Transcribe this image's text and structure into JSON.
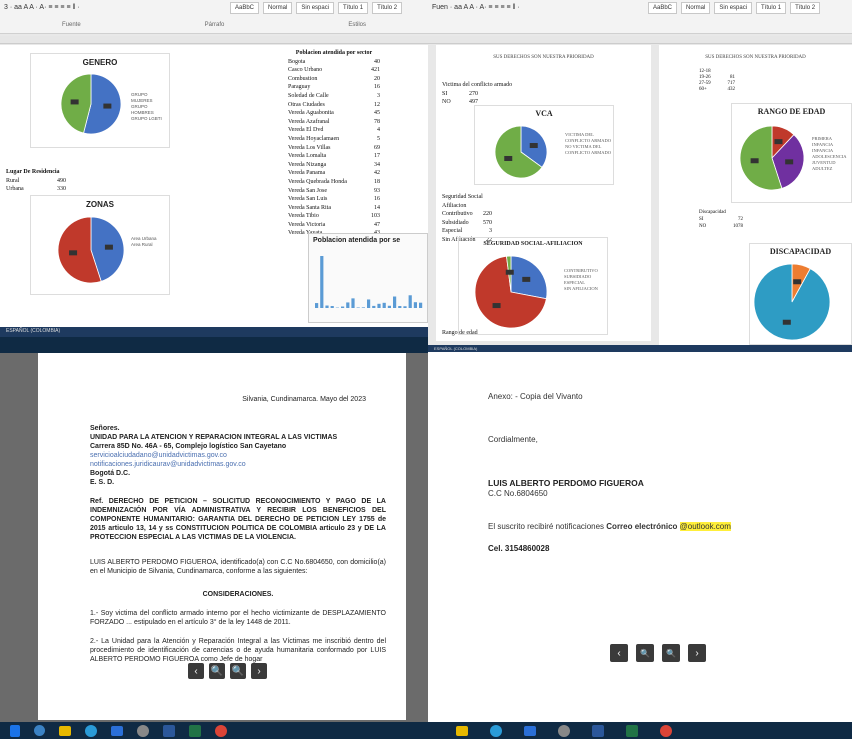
{
  "top_left": {
    "ribbon_text": "Fuente",
    "style_label": "Normal",
    "group_labels": [
      "Fuente",
      "Párrafo",
      "Estilos"
    ],
    "chart_genero": {
      "title": "GENERO",
      "slices": [
        {
          "value": 54,
          "color": "#4472c4"
        },
        {
          "value": 46,
          "color": "#70ad47"
        }
      ],
      "legend": [
        "GRUPO MUJERES",
        "GRUPO HOMBRES",
        "GRUPO LGBTI"
      ]
    },
    "residence_title": "Lugar De Residencia",
    "residence_rows": [
      {
        "k": "Rural",
        "v": "490"
      },
      {
        "k": "Urbana",
        "v": "330"
      }
    ],
    "chart_zonas": {
      "title": "ZONAS",
      "slices": [
        {
          "value": 45,
          "color": "#4472c4"
        },
        {
          "value": 55,
          "color": "#c0392b"
        }
      ],
      "legend": [
        "Area Urbana",
        "Area Rural"
      ]
    },
    "poblacion_title": "Poblacion atendida por sector",
    "sectors": [
      {
        "k": "Bogota",
        "v": "40"
      },
      {
        "k": "Casco Urbano",
        "v": "421"
      },
      {
        "k": "Combustion",
        "v": "20"
      },
      {
        "k": "Paraguay",
        "v": "16"
      },
      {
        "k": "Soledad de Calle",
        "v": "3"
      },
      {
        "k": "Otras Ciudades",
        "v": "12"
      },
      {
        "k": "Vereda Aguabonita",
        "v": "45"
      },
      {
        "k": "Vereda Azafranal",
        "v": "78"
      },
      {
        "k": "Vereda El Dvd",
        "v": "4"
      },
      {
        "k": "Vereda Hoyaclamaen",
        "v": "5"
      },
      {
        "k": "Vereda Los Villas",
        "v": "69"
      },
      {
        "k": "Vereda Lomalta",
        "v": "17"
      },
      {
        "k": "Vereda Nizanga",
        "v": "34"
      },
      {
        "k": "Vereda Panama",
        "v": "42"
      },
      {
        "k": "Vereda Quebrada Honda",
        "v": "18"
      },
      {
        "k": "Vereda San Jose",
        "v": "93"
      },
      {
        "k": "Vereda San Luis",
        "v": "16"
      },
      {
        "k": "Vereda Santa Rita",
        "v": "14"
      },
      {
        "k": "Vereda Tibio",
        "v": "103"
      },
      {
        "k": "Vereda Victoria",
        "v": "47"
      },
      {
        "k": "Vereda Yayata",
        "v": "43"
      }
    ],
    "bar_chart_title": "Poblacion atendida por se"
  },
  "top_right": {
    "ribbon_text": "Fuente",
    "style_label": "Normal",
    "heading": "SUS DERECHOS SON NUESTRA PRIORIDAD",
    "victim_label": "Victima del conflicto armado",
    "victim_rows": [
      {
        "k": "SI",
        "v": "270"
      },
      {
        "k": "NO",
        "v": "497"
      }
    ],
    "chart_vca": {
      "title": "VCA",
      "slices": [
        {
          "value": 35,
          "color": "#4472c4"
        },
        {
          "value": 65,
          "color": "#70ad47"
        }
      ],
      "legend": [
        "VICTIMA DEL CONFLICTO ARMADO",
        "NO VICTIMA DEL CONFLICTO ARMADO"
      ]
    },
    "ss_label": "Seguridad Social Afiliacion",
    "ss_rows": [
      {
        "k": "Contributivo",
        "v": "220"
      },
      {
        "k": "Subsidiado",
        "v": "570"
      },
      {
        "k": "Especial",
        "v": "3"
      },
      {
        "k": "Sin Afiliación",
        "v": "22"
      }
    ],
    "chart_ss": {
      "title": "SEGURIDAD SOCIAL-AFILIACION",
      "slices": [
        {
          "value": 28,
          "color": "#4472c4"
        },
        {
          "value": 70,
          "color": "#c0392b"
        },
        {
          "value": 2,
          "color": "#70ad47"
        }
      ],
      "legend": [
        "CONTRIBUTIVO",
        "SUBSIDIADO",
        "ESPECIAL",
        "SIN AFILIACION"
      ]
    },
    "rango_label": "Rango de edad",
    "age_rows": [
      {
        "k": "12-18",
        "v": ""
      },
      {
        "k": "19-26",
        "v": "81"
      },
      {
        "k": "27-59",
        "v": "717"
      },
      {
        "k": "60+",
        "v": "432"
      }
    ],
    "chart_edad": {
      "title": "RANGO DE EDAD",
      "slices": [
        {
          "value": 12,
          "color": "#c0392b"
        },
        {
          "value": 33,
          "color": "#7030a0"
        },
        {
          "value": 55,
          "color": "#70ad47"
        }
      ],
      "legend": [
        "PRIMERA INFANCIA",
        "INFANCIA",
        "ADOLESCENCIA",
        "JUVENTUD",
        "ADULTEZ"
      ]
    },
    "disc_label": "Discapacidad",
    "disc_rows": [
      {
        "k": "SI",
        "v": "72"
      },
      {
        "k": "NO",
        "v": "1078"
      }
    ],
    "chart_disc": {
      "title": "DISCAPACIDAD",
      "slices": [
        {
          "value": 8,
          "color": "#ed7d31"
        },
        {
          "value": 92,
          "color": "#2e9cc4"
        }
      ],
      "legend": [
        "CON DISCAPACIDAD",
        "SIN DISCAPACIDAD"
      ]
    }
  },
  "language_label": "ESPAÑOL (COLOMBIA)",
  "letter": {
    "place_date": "Silvania, Cundinamarca. Mayo del 2023",
    "salutation": "Señores.",
    "addressee": "UNIDAD PARA LA ATENCION Y REPARACION INTEGRAL A LAS VICTIMAS",
    "address": "Carrera 85D No. 46A - 65, Complejo logístico San Cayetano",
    "email1": "servicioalciudadano@unidadvictimas.gov.co",
    "email2": "notificaciones.juridicaurav@unidadvictimas.gov.co",
    "city": "Bogotá D.C.",
    "esd": "E. S. D.",
    "ref": "Ref. DERECHO DE PETICION – SOLICITUD RECONOCIMIENTO Y PAGO DE LA INDEMNIZACIÓN POR VÍA ADMINISTRATIVA Y RECIBIR LOS BENEFICIOS DEL COMPONENTE HUMANITARIO: GARANTIA DEL DERECHO DE PETICION LEY 1755 de 2015 articulo 13, 14 y ss CONSTITUCION POLITICA DE COLOMBIA articulo 23 y DE LA PROTECCION ESPECIAL A LAS VICTIMAS DE LA VIOLENCIA.",
    "intro": "LUIS ALBERTO PERDOMO FIGUEROA, identificado(a) con C.C No.6804650, con domicilio(a) en el Municipio de Silvania, Cundinamarca, conforme a las siguientes:",
    "considerations": "CONSIDERACIONES.",
    "p1": "1.- Soy victima del conflicto armado interno por el hecho victimizante de DESPLAZAMIENTO FORZADO ... estipulado en el artículo 3° de la ley 1448 de 2011.",
    "p2": "2.- La Unidad para la Atención y Reparación Integral a las Víctimas me inscribió dentro del procedimiento de identificación de carencias o de ayuda humanitaria conformado por LUIS ALBERTO PERDOMO FIGUEROA como Jefe de hogar"
  },
  "signature": {
    "annex": "Anexo: -    Copia del Vivanto",
    "closing": "Cordialmente,",
    "name": "LUIS ALBERTO PERDOMO FIGUEROA",
    "cc": "C.C No.6804650",
    "notif_prefix": "El suscrito recibiré notificaciones",
    "notif_bold": "Correo electrónico",
    "email": "@outlook.com",
    "cel": "Cel. 3154860028"
  },
  "nav": {
    "prev": "‹",
    "zoom_out": "🔍",
    "zoom_in": "🔍",
    "next": "›"
  }
}
